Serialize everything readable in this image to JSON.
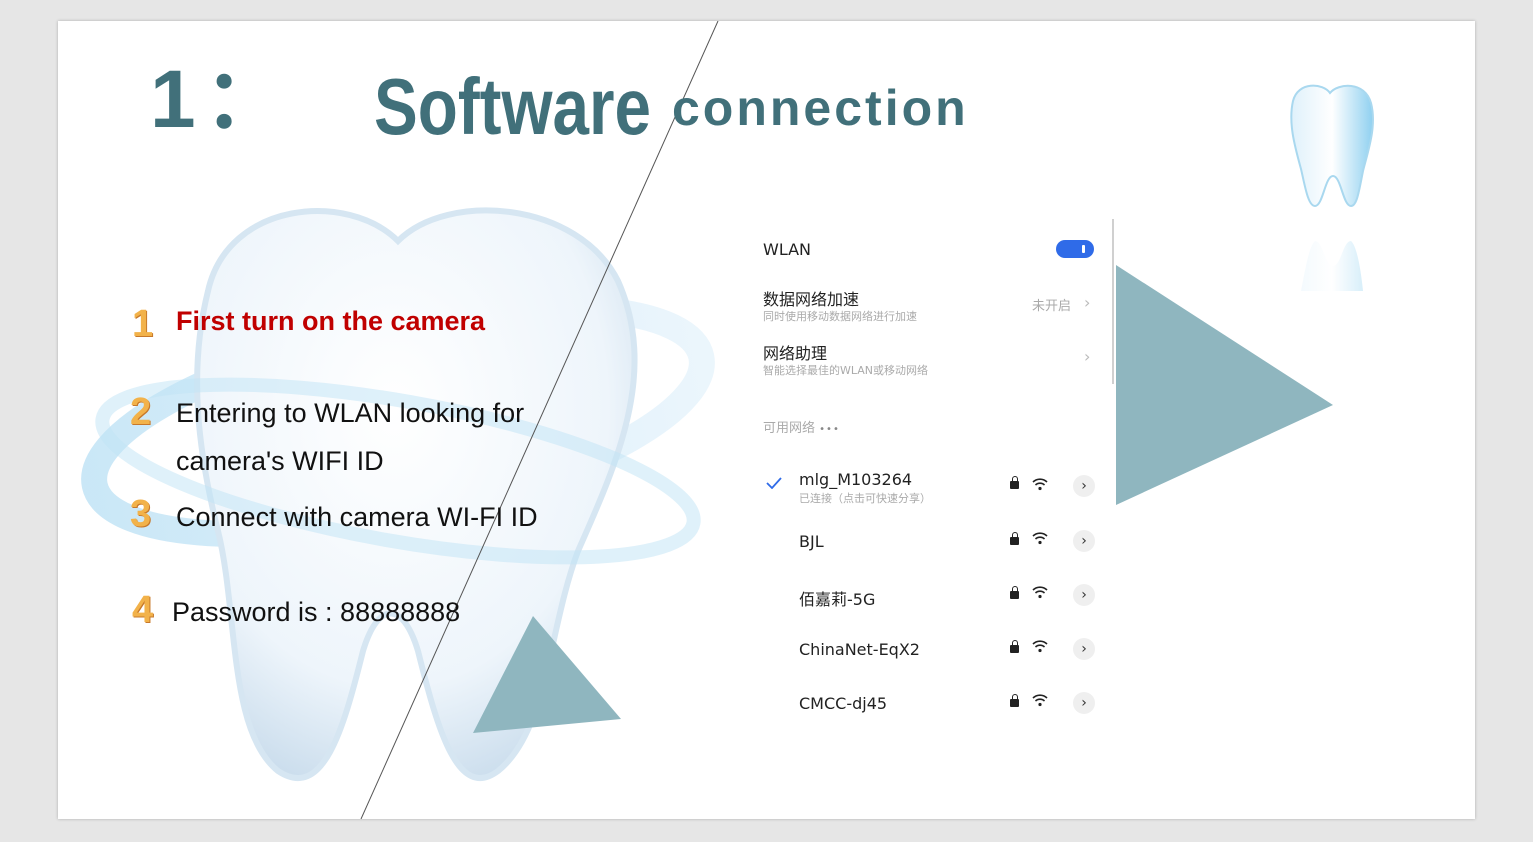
{
  "slide": {
    "title_number": "1：",
    "title_main": "Software",
    "title_sub": "connection"
  },
  "steps": [
    {
      "number": "1",
      "text": "First turn on the camera"
    },
    {
      "number": "2",
      "line1": "Entering to WLAN looking for",
      "line2": "camera's WIFI ID"
    },
    {
      "number": "3",
      "text": "Connect with camera WI-FI ID"
    },
    {
      "number": "4",
      "text": "Password is : 88888888"
    }
  ],
  "wlan": {
    "title": "WLAN",
    "toggle_on": true,
    "accel_title": "数据网络加速",
    "accel_sub": "同时使用移动数据网络进行加速",
    "accel_value": "未开启",
    "assistant_title": "网络助理",
    "assistant_sub": "智能选择最佳的WLAN或移动网络",
    "available_label": "可用网络",
    "networks": [
      {
        "name": "mlg_M103264",
        "status": "已连接（点击可快速分享）",
        "connected": true
      },
      {
        "name": "BJL",
        "status": ""
      },
      {
        "name": "佰嘉莉-5G",
        "status": ""
      },
      {
        "name": "ChinaNet-EqX2",
        "status": ""
      },
      {
        "name": "CMCC-dj45",
        "status": ""
      }
    ]
  },
  "colors": {
    "title": "#41707a",
    "accent_triangle": "#8fb6bf",
    "step1": "#c00000",
    "toggle": "#2f6be8"
  },
  "icons": [
    "tooth-illustration",
    "tooth-icon",
    "check-icon",
    "lock-icon",
    "wifi-icon",
    "chevron-right-icon"
  ]
}
